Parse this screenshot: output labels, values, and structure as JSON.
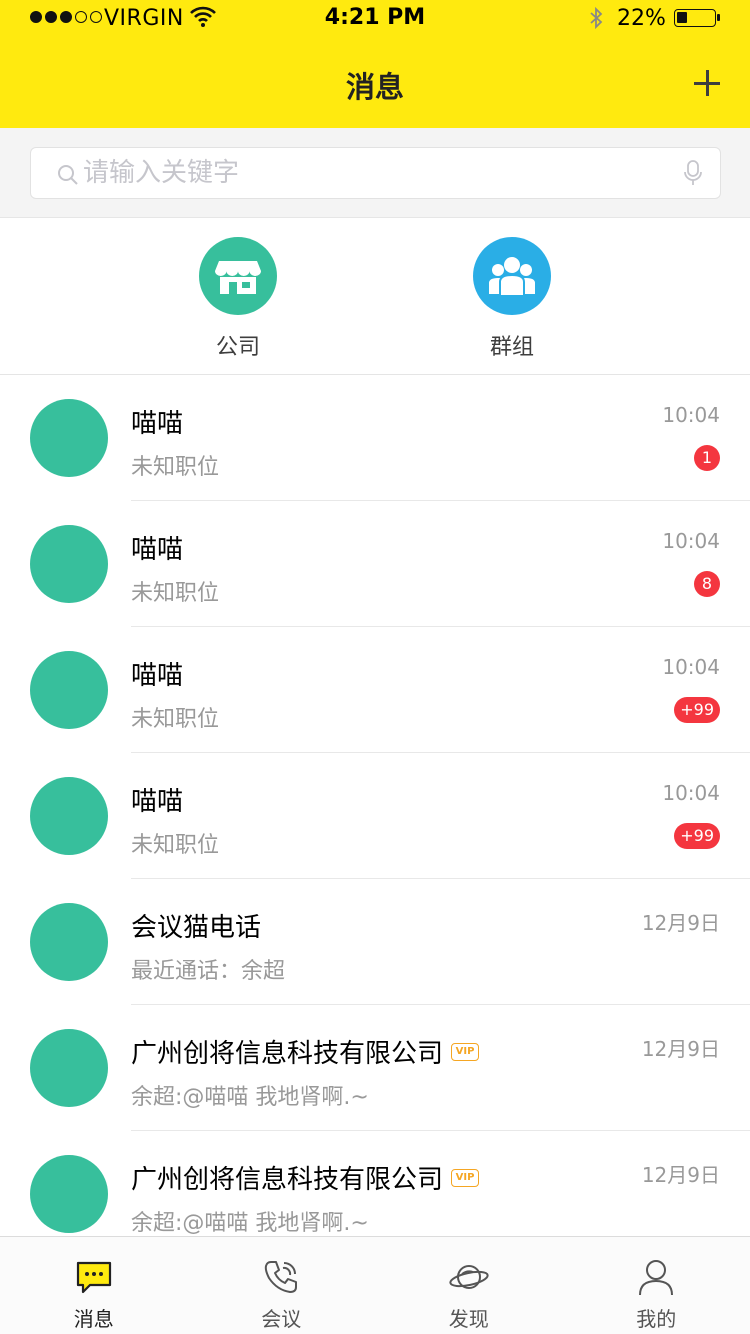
{
  "status_bar": {
    "carrier": "VIRGIN",
    "time": "4:21 PM",
    "battery": "22%"
  },
  "header": {
    "title": "消息"
  },
  "search": {
    "placeholder": "请输入关键字"
  },
  "shortcuts": [
    {
      "label": "公司",
      "icon": "store-icon",
      "color": "#37bf9c"
    },
    {
      "label": "群组",
      "icon": "group-icon",
      "color": "#2aaee6"
    }
  ],
  "messages": [
    {
      "name": "喵喵",
      "sub": "未知职位",
      "time": "10:04",
      "badge": "1"
    },
    {
      "name": "喵喵",
      "sub": "未知职位",
      "time": "10:04",
      "badge": "8"
    },
    {
      "name": "喵喵",
      "sub": "未知职位",
      "time": "10:04",
      "badge": "+99"
    },
    {
      "name": "喵喵",
      "sub": "未知职位",
      "time": "10:04",
      "badge": "+99"
    },
    {
      "name": "会议猫电话",
      "sub": "最近通话：余超",
      "time": "12月9日"
    },
    {
      "name": "广州创将信息科技有限公司",
      "vip": "VIP",
      "sub": "余超:@喵喵 我地肾啊.~",
      "time": "12月9日"
    },
    {
      "name": "广州创将信息科技有限公司",
      "vip": "VIP",
      "sub": "余超:@喵喵 我地肾啊.~",
      "time": "12月9日"
    }
  ],
  "tabs": [
    {
      "label": "消息",
      "icon": "chat-icon",
      "active": true
    },
    {
      "label": "会议",
      "icon": "phone-icon"
    },
    {
      "label": "发现",
      "icon": "planet-icon"
    },
    {
      "label": "我的",
      "icon": "user-icon"
    }
  ],
  "colors": {
    "header_bg": "#ffea0f",
    "avatar": "#37bf9c",
    "badge": "#f4363f",
    "vip": "#f5a623",
    "placeholder": "#c6c6cc",
    "secondary_text": "#999999"
  }
}
